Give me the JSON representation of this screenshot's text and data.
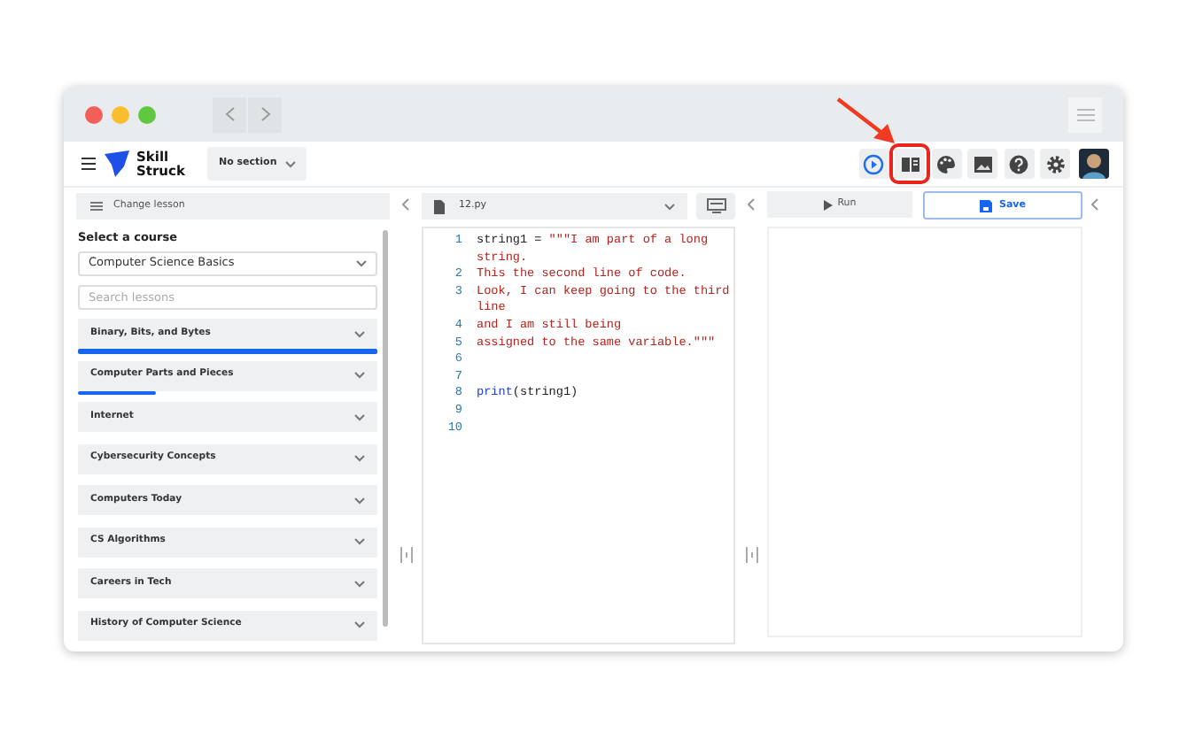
{
  "header": {
    "brand_lines": [
      "Skill",
      "Struck"
    ],
    "section_dropdown": {
      "value": "No section"
    },
    "toolbar": [
      {
        "kind": "run",
        "highlighted": false
      },
      {
        "kind": "book",
        "highlighted": true
      },
      {
        "kind": "palette",
        "highlighted": false
      },
      {
        "kind": "image",
        "highlighted": false
      },
      {
        "kind": "help",
        "highlighted": false
      },
      {
        "kind": "settings",
        "highlighted": false
      }
    ]
  },
  "sidebar": {
    "change_lesson": "Change lesson",
    "heading": "Select a course",
    "course_select": {
      "value": "Computer Science Basics"
    },
    "search": {
      "placeholder": "Search lessons"
    },
    "units": [
      {
        "title": "Binary, Bits, and Bytes",
        "level": 1
      },
      {
        "title": "Computer Parts and Pieces",
        "level": 0.26
      },
      {
        "title": "Internet"
      },
      {
        "title": "Cybersecurity Concepts"
      },
      {
        "title": "Computers Today"
      },
      {
        "title": "CS Algorithms"
      },
      {
        "title": "Careers in Tech"
      },
      {
        "title": "History of Computer Science"
      }
    ]
  },
  "editor": {
    "file": "12.py",
    "lines": [
      {
        "number": "1",
        "segments": [
          {
            "kind": "plain",
            "text": "string1 = "
          },
          {
            "kind": "string",
            "text": "\"\"\"I am part of a long string."
          }
        ]
      },
      {
        "number": "2",
        "segments": [
          {
            "kind": "string",
            "text": "This the second line of code."
          }
        ]
      },
      {
        "number": "3",
        "segments": [
          {
            "kind": "string",
            "text": "Look, I can keep going to the third line"
          }
        ]
      },
      {
        "number": "4",
        "segments": [
          {
            "kind": "string",
            "text": "and I am still being"
          }
        ]
      },
      {
        "number": "5",
        "segments": [
          {
            "kind": "string",
            "text": "assigned to the same variable.\"\"\""
          }
        ]
      },
      {
        "number": "6"
      },
      {
        "number": "7"
      },
      {
        "number": "8",
        "segments": [
          {
            "kind": "builtin",
            "text": "print"
          },
          {
            "kind": "plain",
            "text": "(string1)"
          }
        ]
      },
      {
        "number": "9"
      },
      {
        "number": "10"
      }
    ]
  },
  "output": {
    "run": "Run",
    "save": "Save"
  }
}
